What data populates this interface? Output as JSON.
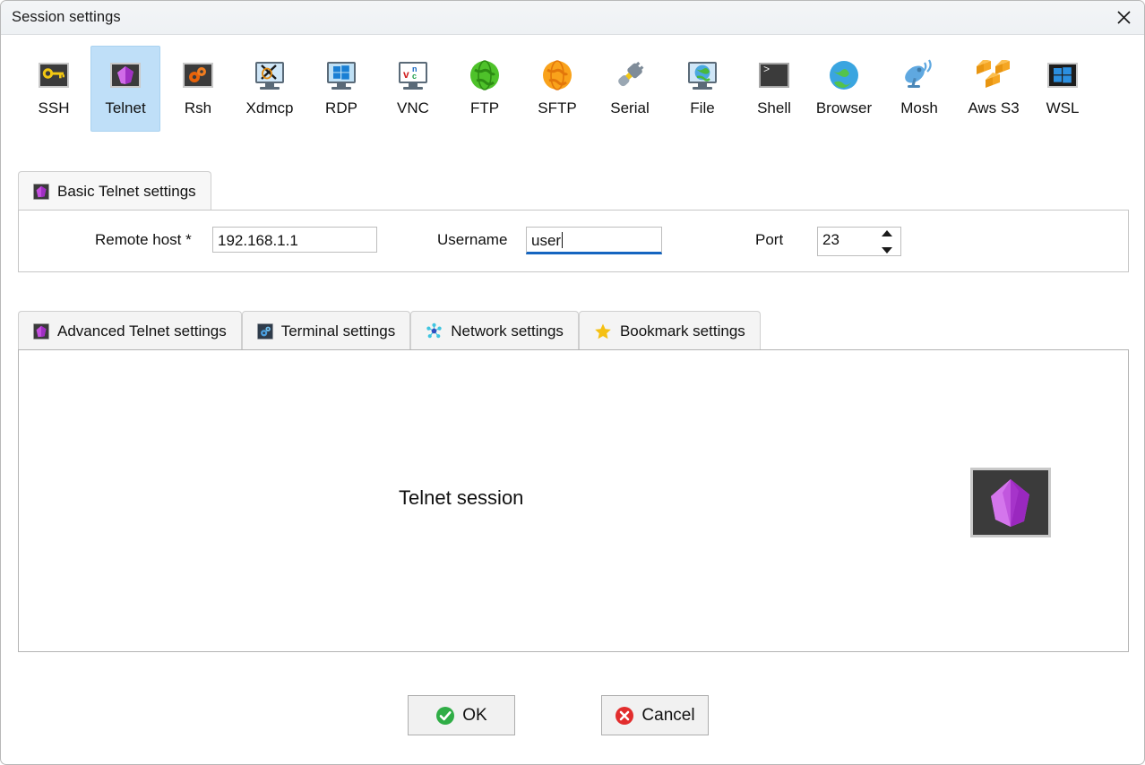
{
  "window": {
    "title": "Session settings",
    "close_icon": "close-icon"
  },
  "protocols": [
    {
      "label": "SSH",
      "icon": "ssh-key-icon",
      "selected": false
    },
    {
      "label": "Telnet",
      "icon": "telnet-gem-icon",
      "selected": true
    },
    {
      "label": "Rsh",
      "icon": "rsh-gears-icon",
      "selected": false
    },
    {
      "label": "Xdmcp",
      "icon": "xdmcp-monitor-icon",
      "selected": false
    },
    {
      "label": "RDP",
      "icon": "rdp-windows-icon",
      "selected": false
    },
    {
      "label": "VNC",
      "icon": "vnc-monitor-icon",
      "selected": false
    },
    {
      "label": "FTP",
      "icon": "ftp-globe-icon",
      "selected": false
    },
    {
      "label": "SFTP",
      "icon": "sftp-globe-icon",
      "selected": false
    },
    {
      "label": "Serial",
      "icon": "serial-plug-icon",
      "selected": false
    },
    {
      "label": "File",
      "icon": "file-monitor-icon",
      "selected": false
    },
    {
      "label": "Shell",
      "icon": "shell-console-icon",
      "selected": false
    },
    {
      "label": "Browser",
      "icon": "browser-globe-icon",
      "selected": false
    },
    {
      "label": "Mosh",
      "icon": "mosh-dish-icon",
      "selected": false
    },
    {
      "label": "Aws S3",
      "icon": "aws-s3-cubes-icon",
      "selected": false
    },
    {
      "label": "WSL",
      "icon": "wsl-windows-icon",
      "selected": false
    }
  ],
  "basic_tab": {
    "label": "Basic Telnet settings",
    "icon": "telnet-gem-icon"
  },
  "form": {
    "remote_host_label": "Remote host *",
    "remote_host_value": "192.168.1.1",
    "remote_host_placeholder": "",
    "username_label": "Username",
    "username_value": "user",
    "username_placeholder": "",
    "port_label": "Port",
    "port_value": "23"
  },
  "lower_tabs": [
    {
      "label": "Advanced Telnet settings",
      "icon": "telnet-gem-icon",
      "active": false
    },
    {
      "label": "Terminal settings",
      "icon": "terminal-gear-icon",
      "active": false
    },
    {
      "label": "Network settings",
      "icon": "network-hub-icon",
      "active": false
    },
    {
      "label": "Bookmark settings",
      "icon": "star-icon",
      "active": false
    }
  ],
  "session_panel": {
    "caption": "Telnet session",
    "big_icon": "telnet-gem-icon"
  },
  "buttons": {
    "ok_label": "OK",
    "ok_icon": "check-circle-icon",
    "cancel_label": "Cancel",
    "cancel_icon": "x-circle-icon"
  },
  "colors": {
    "selection": "#bfdff8",
    "focus_underline": "#1565c0",
    "ok_green": "#2fad46",
    "cancel_red": "#e22d2d",
    "telnet_purple": "#b74edb",
    "star_yellow": "#f5c012"
  }
}
